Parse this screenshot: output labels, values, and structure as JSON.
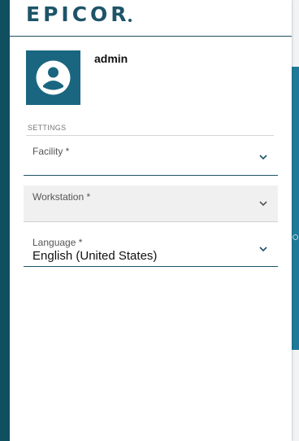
{
  "brand": {
    "logo_text": "EPICOR",
    "primary_color": "#1d5468",
    "accent_color": "#1f7a99"
  },
  "user": {
    "username": "admin",
    "avatar_icon": "user-circle-icon"
  },
  "settings": {
    "section_label": "SETTINGS",
    "facility": {
      "label": "Facility *",
      "value": ""
    },
    "workstation": {
      "label": "Workstation *",
      "value": ""
    },
    "language": {
      "label": "Language *",
      "value": "English (United States)"
    }
  }
}
